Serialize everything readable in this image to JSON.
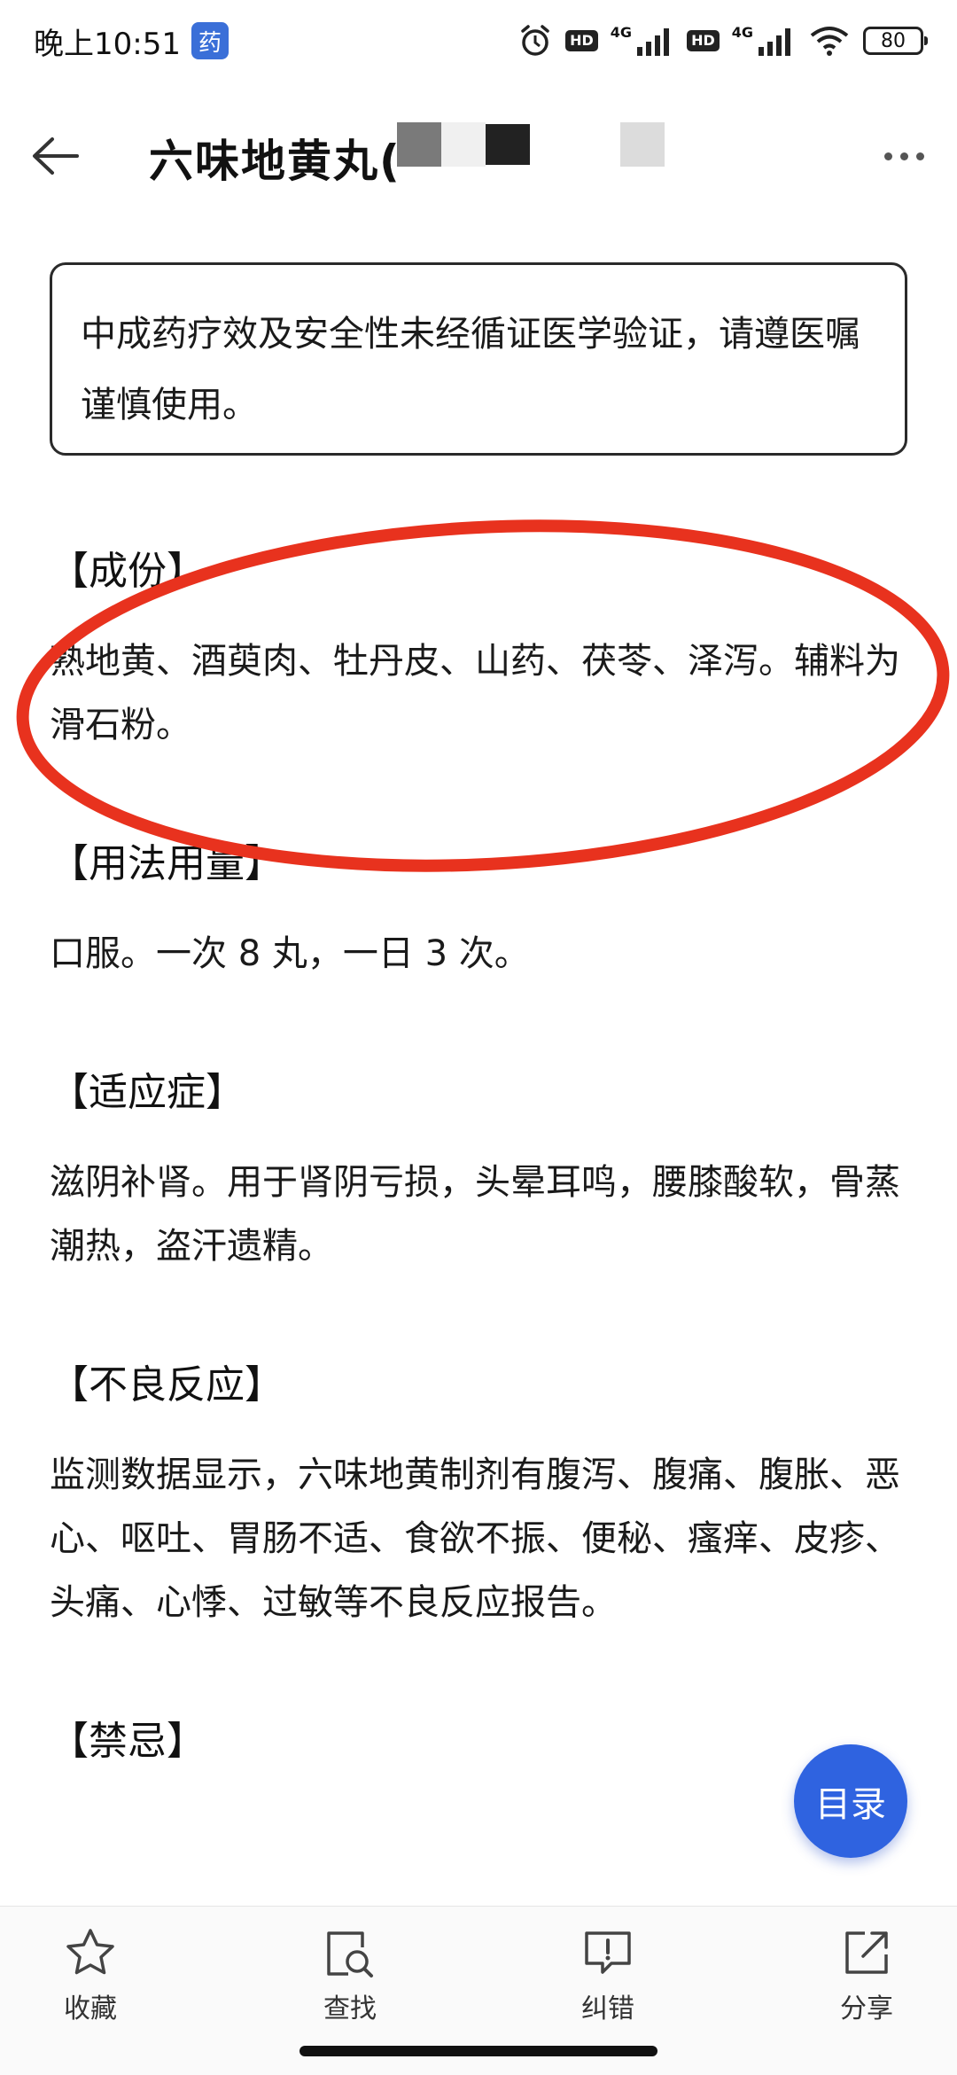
{
  "status_bar": {
    "time": "晚上10:51",
    "app_badge": "药",
    "hd1": "HD",
    "net1": "4G",
    "hd2": "HD",
    "net2": "4G",
    "battery": "80"
  },
  "header": {
    "title": "六味地黄丸("
  },
  "notice": "中成药疗效及安全性未经循证医学验证，请遵医嘱谨慎使用。",
  "sections": [
    {
      "heading": "【成份】",
      "body": "熟地黄、酒萸肉、牡丹皮、山药、茯苓、泽泻。辅料为滑石粉。"
    },
    {
      "heading": "【用法用量】",
      "body": "口服。一次 8 丸，一日 3 次。"
    },
    {
      "heading": "【适应症】",
      "body": "滋阴补肾。用于肾阴亏损，头晕耳鸣，腰膝酸软，骨蒸潮热，盗汗遗精。"
    },
    {
      "heading": "【不良反应】",
      "body": "监测数据显示，六味地黄制剂有腹泻、腹痛、腹胀、恶心、呕吐、胃肠不适、食欲不振、便秘、瘙痒、皮疹、头痛、心悸、过敏等不良反应报告。"
    },
    {
      "heading": "【禁忌】",
      "body": ""
    }
  ],
  "fab_label": "目录",
  "bottom_tabs": [
    {
      "label": "收藏",
      "icon": "star-icon"
    },
    {
      "label": "查找",
      "icon": "search-document-icon"
    },
    {
      "label": "纠错",
      "icon": "report-error-icon"
    },
    {
      "label": "分享",
      "icon": "share-icon"
    }
  ],
  "colors": {
    "accent": "#2f63e0",
    "annotation_circle": "#e8321e"
  }
}
